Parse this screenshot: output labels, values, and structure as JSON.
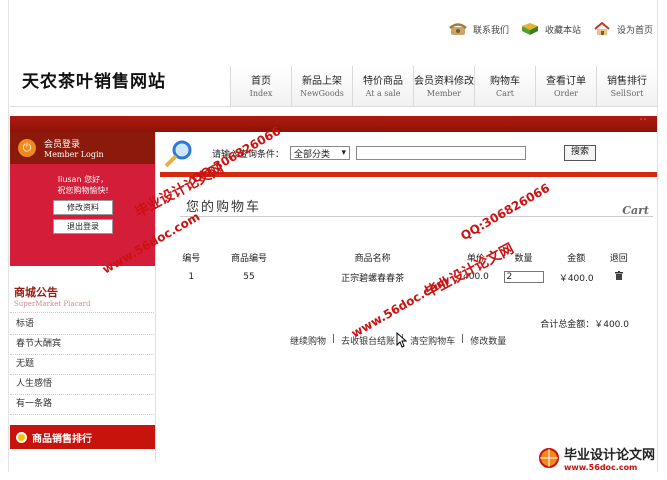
{
  "toplinks": {
    "contact": "联系我们",
    "favorite": "收藏本站",
    "homepage": "设为首页"
  },
  "site_title": "天农茶叶销售网站",
  "nav": [
    {
      "cn": "首页",
      "en": "Index"
    },
    {
      "cn": "新品上架",
      "en": "NewGoods"
    },
    {
      "cn": "特价商品",
      "en": "At a sale"
    },
    {
      "cn": "会员资料修改",
      "en": "Member"
    },
    {
      "cn": "购物车",
      "en": "Cart"
    },
    {
      "cn": "查看订单",
      "en": "Order"
    },
    {
      "cn": "销售排行",
      "en": "SellSort"
    }
  ],
  "login": {
    "title_cn": "会员登录",
    "title_en": "Member Login",
    "greeting_line1": "liusan 您好，",
    "greeting_line2": "祝您购物愉快!",
    "edit_button": "修改资料",
    "logout_button": "退出登录"
  },
  "notice": {
    "title_cn": "商城公告",
    "title_en": "SuperMarket Placard",
    "items": [
      "标语",
      "春节大酬宾",
      "无题",
      "人生感悟",
      "有一条路"
    ]
  },
  "ranking_title": "商品销售排行",
  "search": {
    "label": "请输入查询条件：",
    "category": "全部分类",
    "button": "搜索"
  },
  "cart": {
    "title": "您的购物车",
    "title_en": "Cart",
    "columns": [
      "编号",
      "商品编号",
      "商品名称",
      "单价",
      "数量",
      "金额",
      "退回"
    ],
    "rows": [
      {
        "no": "1",
        "product_id": "55",
        "name": "正宗碧螺春春茶",
        "price": "400.0",
        "qty": "2",
        "amount": "￥400.0"
      }
    ],
    "total_label": "合计总金额：￥400.0",
    "actions": [
      "继续购物",
      "去收银台结账",
      "清空购物车",
      "修改数量"
    ]
  },
  "watermarks": {
    "site_cn": "毕业设计论文网",
    "site_url": "www.56doc.com",
    "qq": "QQ:306826066"
  },
  "colors": {
    "brand_red": "#c8120c",
    "dark_red": "#8b1a0d",
    "login_pink": "#d41d38",
    "watermark": "#cc1111"
  }
}
